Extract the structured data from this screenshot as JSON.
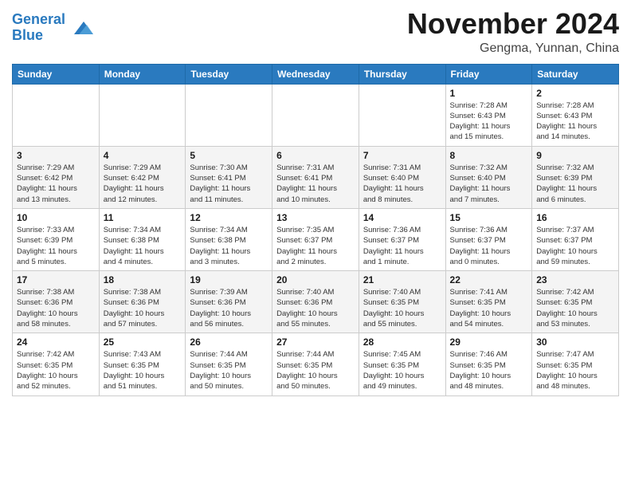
{
  "header": {
    "logo_line1": "General",
    "logo_line2": "Blue",
    "month": "November 2024",
    "location": "Gengma, Yunnan, China"
  },
  "weekdays": [
    "Sunday",
    "Monday",
    "Tuesday",
    "Wednesday",
    "Thursday",
    "Friday",
    "Saturday"
  ],
  "weeks": [
    [
      {
        "day": "",
        "info": ""
      },
      {
        "day": "",
        "info": ""
      },
      {
        "day": "",
        "info": ""
      },
      {
        "day": "",
        "info": ""
      },
      {
        "day": "",
        "info": ""
      },
      {
        "day": "1",
        "info": "Sunrise: 7:28 AM\nSunset: 6:43 PM\nDaylight: 11 hours\nand 15 minutes."
      },
      {
        "day": "2",
        "info": "Sunrise: 7:28 AM\nSunset: 6:43 PM\nDaylight: 11 hours\nand 14 minutes."
      }
    ],
    [
      {
        "day": "3",
        "info": "Sunrise: 7:29 AM\nSunset: 6:42 PM\nDaylight: 11 hours\nand 13 minutes."
      },
      {
        "day": "4",
        "info": "Sunrise: 7:29 AM\nSunset: 6:42 PM\nDaylight: 11 hours\nand 12 minutes."
      },
      {
        "day": "5",
        "info": "Sunrise: 7:30 AM\nSunset: 6:41 PM\nDaylight: 11 hours\nand 11 minutes."
      },
      {
        "day": "6",
        "info": "Sunrise: 7:31 AM\nSunset: 6:41 PM\nDaylight: 11 hours\nand 10 minutes."
      },
      {
        "day": "7",
        "info": "Sunrise: 7:31 AM\nSunset: 6:40 PM\nDaylight: 11 hours\nand 8 minutes."
      },
      {
        "day": "8",
        "info": "Sunrise: 7:32 AM\nSunset: 6:40 PM\nDaylight: 11 hours\nand 7 minutes."
      },
      {
        "day": "9",
        "info": "Sunrise: 7:32 AM\nSunset: 6:39 PM\nDaylight: 11 hours\nand 6 minutes."
      }
    ],
    [
      {
        "day": "10",
        "info": "Sunrise: 7:33 AM\nSunset: 6:39 PM\nDaylight: 11 hours\nand 5 minutes."
      },
      {
        "day": "11",
        "info": "Sunrise: 7:34 AM\nSunset: 6:38 PM\nDaylight: 11 hours\nand 4 minutes."
      },
      {
        "day": "12",
        "info": "Sunrise: 7:34 AM\nSunset: 6:38 PM\nDaylight: 11 hours\nand 3 minutes."
      },
      {
        "day": "13",
        "info": "Sunrise: 7:35 AM\nSunset: 6:37 PM\nDaylight: 11 hours\nand 2 minutes."
      },
      {
        "day": "14",
        "info": "Sunrise: 7:36 AM\nSunset: 6:37 PM\nDaylight: 11 hours\nand 1 minute."
      },
      {
        "day": "15",
        "info": "Sunrise: 7:36 AM\nSunset: 6:37 PM\nDaylight: 11 hours\nand 0 minutes."
      },
      {
        "day": "16",
        "info": "Sunrise: 7:37 AM\nSunset: 6:37 PM\nDaylight: 10 hours\nand 59 minutes."
      }
    ],
    [
      {
        "day": "17",
        "info": "Sunrise: 7:38 AM\nSunset: 6:36 PM\nDaylight: 10 hours\nand 58 minutes."
      },
      {
        "day": "18",
        "info": "Sunrise: 7:38 AM\nSunset: 6:36 PM\nDaylight: 10 hours\nand 57 minutes."
      },
      {
        "day": "19",
        "info": "Sunrise: 7:39 AM\nSunset: 6:36 PM\nDaylight: 10 hours\nand 56 minutes."
      },
      {
        "day": "20",
        "info": "Sunrise: 7:40 AM\nSunset: 6:36 PM\nDaylight: 10 hours\nand 55 minutes."
      },
      {
        "day": "21",
        "info": "Sunrise: 7:40 AM\nSunset: 6:35 PM\nDaylight: 10 hours\nand 55 minutes."
      },
      {
        "day": "22",
        "info": "Sunrise: 7:41 AM\nSunset: 6:35 PM\nDaylight: 10 hours\nand 54 minutes."
      },
      {
        "day": "23",
        "info": "Sunrise: 7:42 AM\nSunset: 6:35 PM\nDaylight: 10 hours\nand 53 minutes."
      }
    ],
    [
      {
        "day": "24",
        "info": "Sunrise: 7:42 AM\nSunset: 6:35 PM\nDaylight: 10 hours\nand 52 minutes."
      },
      {
        "day": "25",
        "info": "Sunrise: 7:43 AM\nSunset: 6:35 PM\nDaylight: 10 hours\nand 51 minutes."
      },
      {
        "day": "26",
        "info": "Sunrise: 7:44 AM\nSunset: 6:35 PM\nDaylight: 10 hours\nand 50 minutes."
      },
      {
        "day": "27",
        "info": "Sunrise: 7:44 AM\nSunset: 6:35 PM\nDaylight: 10 hours\nand 50 minutes."
      },
      {
        "day": "28",
        "info": "Sunrise: 7:45 AM\nSunset: 6:35 PM\nDaylight: 10 hours\nand 49 minutes."
      },
      {
        "day": "29",
        "info": "Sunrise: 7:46 AM\nSunset: 6:35 PM\nDaylight: 10 hours\nand 48 minutes."
      },
      {
        "day": "30",
        "info": "Sunrise: 7:47 AM\nSunset: 6:35 PM\nDaylight: 10 hours\nand 48 minutes."
      }
    ]
  ]
}
